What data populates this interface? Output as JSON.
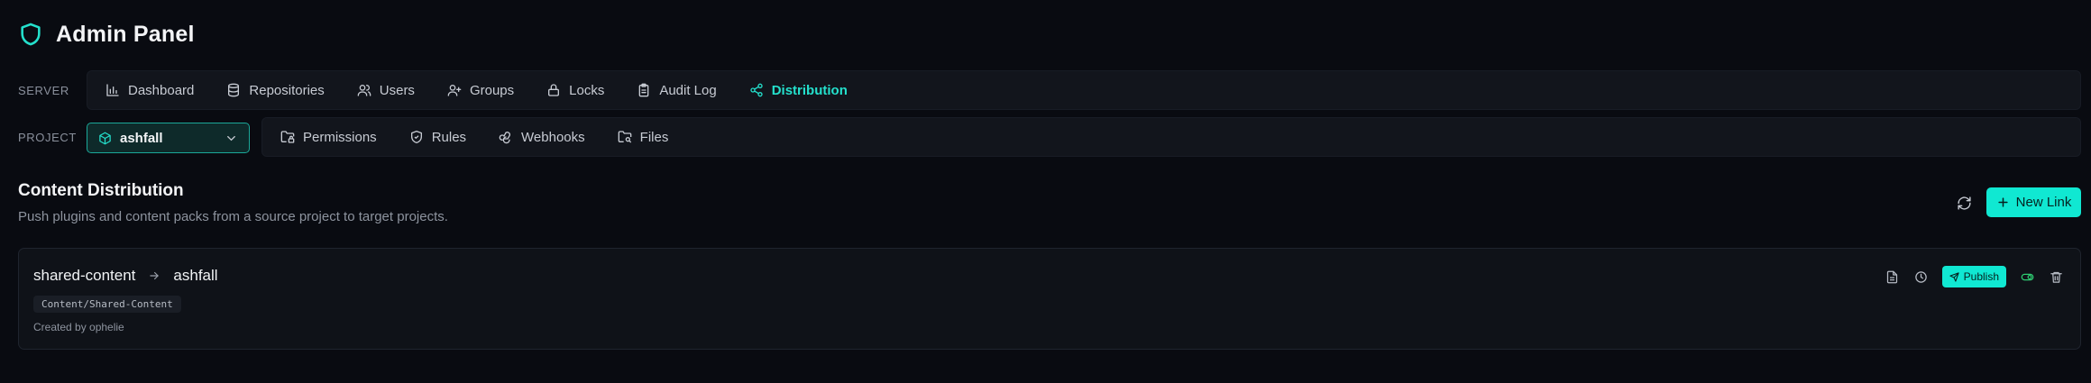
{
  "app": {
    "title": "Admin Panel",
    "logo_icon": "shield-icon"
  },
  "colors": {
    "accent": "#10e8d2",
    "background": "#090b11",
    "active_nav": "#24e0cc"
  },
  "server_nav": {
    "label": "SERVER",
    "items": [
      {
        "label": "Dashboard",
        "icon": "bar-chart-icon",
        "active": false
      },
      {
        "label": "Repositories",
        "icon": "database-icon",
        "active": false
      },
      {
        "label": "Users",
        "icon": "users-icon",
        "active": false
      },
      {
        "label": "Groups",
        "icon": "user-plus-icon",
        "active": false
      },
      {
        "label": "Locks",
        "icon": "lock-icon",
        "active": false
      },
      {
        "label": "Audit Log",
        "icon": "clipboard-icon",
        "active": false
      },
      {
        "label": "Distribution",
        "icon": "share-icon",
        "active": true
      }
    ]
  },
  "project_nav": {
    "label": "PROJECT",
    "selected_project": "ashfall",
    "items": [
      {
        "label": "Permissions",
        "icon": "folder-lock-icon"
      },
      {
        "label": "Rules",
        "icon": "shield-check-icon"
      },
      {
        "label": "Webhooks",
        "icon": "webhook-icon"
      },
      {
        "label": "Files",
        "icon": "folder-search-icon"
      }
    ]
  },
  "section": {
    "title": "Content Distribution",
    "subtitle": "Push plugins and content packs from a source project to target projects.",
    "new_link_label": "New Link"
  },
  "links": [
    {
      "source": "shared-content",
      "target": "ashfall",
      "path": "Content/Shared-Content",
      "created_by": "Created by ophelie",
      "publish_label": "Publish",
      "enabled": true
    }
  ]
}
